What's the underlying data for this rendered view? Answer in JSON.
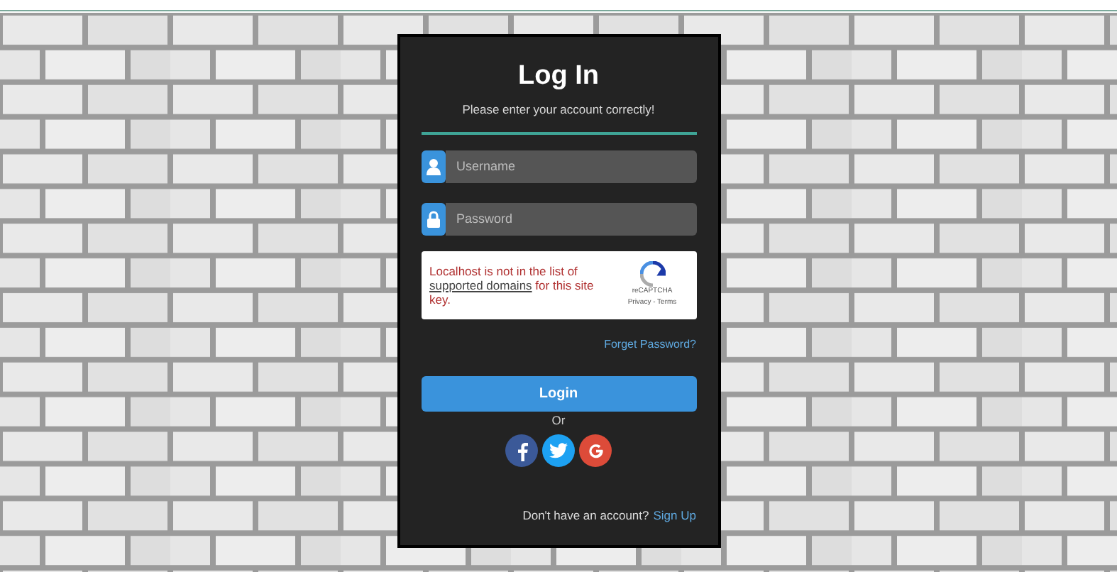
{
  "login_card": {
    "title": "Log In",
    "subtitle": "Please enter your account correctly!",
    "fields": [
      {
        "kind": "user",
        "placeholder": "Username"
      },
      {
        "kind": "lock",
        "placeholder": "Password"
      }
    ],
    "captcha": {
      "message_start": "Localhost is not in the list of",
      "link": "supported domains",
      "message_end": "for this site key.",
      "brand": "reCAPTCHA",
      "footer": "Privacy - Terms"
    },
    "forgot_link": "Forget Password?",
    "login_button": "Login",
    "separator": "Or",
    "social": [
      {
        "kind": "facebook",
        "color": "#3b5998"
      },
      {
        "kind": "twitter",
        "color": "#1da1f2"
      },
      {
        "kind": "google",
        "color": "#dd4b39"
      }
    ],
    "signup_prompt": "Don't have an account?",
    "signup_link": "Sign Up"
  }
}
